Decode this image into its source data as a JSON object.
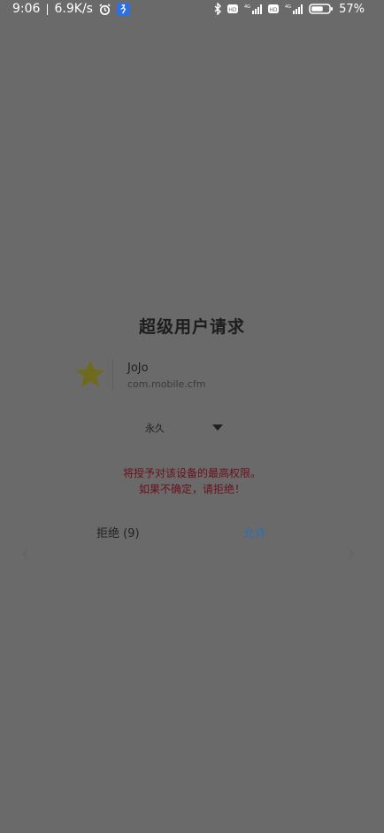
{
  "status_bar": {
    "time": "9:06",
    "net_speed": "6.9K/s",
    "net_label": "4G",
    "battery": "57%",
    "icons": [
      "separator-bar",
      "alarm-icon",
      "running-app-icon",
      "bluetooth-icon",
      "hd-icon",
      "signal-icon-1",
      "hd-icon",
      "signal-icon-2",
      "battery-icon"
    ]
  },
  "dialog": {
    "title": "超级用户请求",
    "app": {
      "name": "JoJo",
      "package": "com.mobile.cfm",
      "icon": "star-icon",
      "icon_color": "#6f6a1e"
    },
    "duration": {
      "selected": "永久"
    },
    "warning": {
      "line1": "将授予对该设备的最高权限。",
      "line2": "如果不确定，请拒绝！"
    },
    "buttons": {
      "deny": "拒绝 (9)",
      "allow": "允许"
    }
  },
  "colors": {
    "background": "#6a6a6a",
    "warning": "#6b0f1c",
    "allow": "#2b6fb6"
  }
}
